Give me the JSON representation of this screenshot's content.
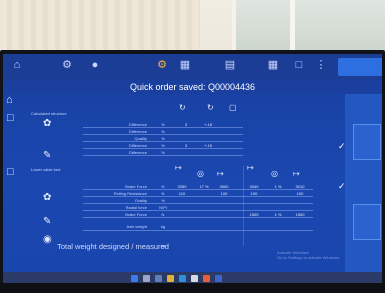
{
  "header": {
    "title": "Quick order saved: Q00004436"
  },
  "sections": [
    {
      "label": "Calculated structure"
    },
    {
      "label": "Lower cable bed"
    }
  ],
  "rows_top": [
    {
      "label": "Difference",
      "unit": "%",
      "v1": "3",
      "v2": "+.15"
    },
    {
      "label": "Difference",
      "unit": "%",
      "v1": "",
      "v2": ""
    },
    {
      "label": "Quality",
      "unit": "%",
      "v1": "",
      "v2": ""
    },
    {
      "label": "Difference",
      "unit": "%",
      "v1": "3",
      "v2": "+.19"
    },
    {
      "label": "Difference",
      "unit": "%",
      "v1": "",
      "v2": ""
    }
  ],
  "rows_bottom": [
    {
      "label": "Brake Force",
      "unit": "N",
      "cells": [
        "3350",
        "17 %",
        "3900",
        "3040",
        "1 %",
        "3010"
      ]
    },
    {
      "label": "Rolling Resistance",
      "unit": "N",
      "cells": [
        "110",
        "",
        "100",
        "100",
        "",
        "100"
      ]
    },
    {
      "label": "Ovality",
      "unit": "%",
      "cells": [
        "",
        "",
        "",
        "",
        "",
        ""
      ]
    },
    {
      "label": "Radial force",
      "unit": "N/PI",
      "cells": [
        "",
        "",
        "",
        "",
        "",
        ""
      ]
    },
    {
      "label": "Brake Force",
      "unit": "N",
      "cells": [
        "",
        "",
        "",
        "1500",
        "1 %",
        "1500"
      ]
    },
    {
      "label": "Axle weight",
      "unit": "kg",
      "cells": [
        "",
        "",
        "",
        "",
        "",
        ""
      ]
    }
  ],
  "total": {
    "label": "Total weight designed / measured",
    "unit": "kg"
  },
  "watermark": {
    "line1": "Activate Windows",
    "line2": "Go to Settings to activate Windows."
  },
  "icons": {
    "toolbar": [
      "robot-icon",
      "globe-icon",
      "settings-icon",
      "factory-icon",
      "printer-icon",
      "calculator-icon",
      "document-icon",
      "menu-icon"
    ],
    "columns_top": [
      "refresh-icon",
      "refresh-icon",
      "trash-icon"
    ],
    "columns_bottom": [
      "width-icon",
      "percent-icon",
      "width-icon",
      "width-icon",
      "percent-icon",
      "width-icon"
    ]
  },
  "colors": {
    "screen_bg": "#1a47b0",
    "toolbar_bg": "#1c3d96",
    "accent": "#f0b43c"
  }
}
